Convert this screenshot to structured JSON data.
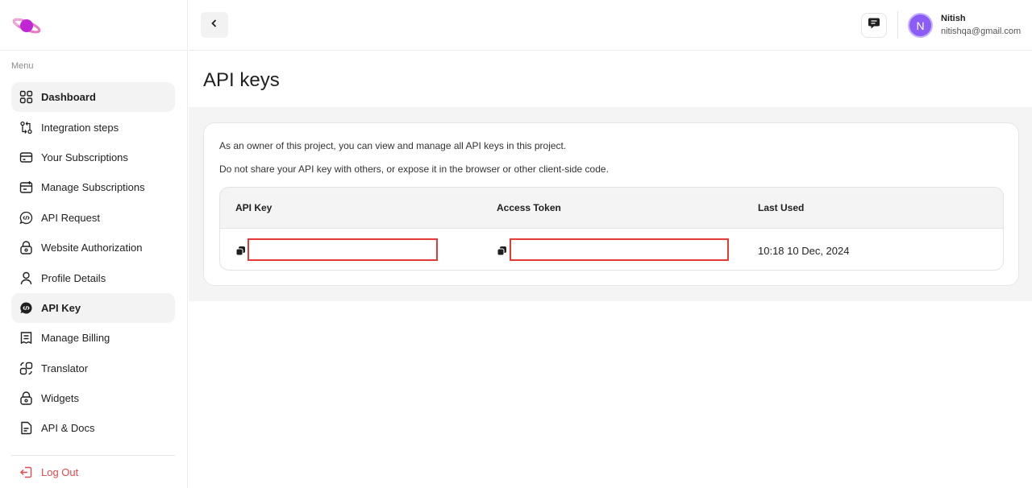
{
  "sidebar": {
    "menu_label": "Menu",
    "items": [
      {
        "label": "Dashboard",
        "icon": "grid-icon",
        "active": true
      },
      {
        "label": "Integration steps",
        "icon": "git-compare-icon"
      },
      {
        "label": "Your Subscriptions",
        "icon": "card-icon"
      },
      {
        "label": "Manage Subscriptions",
        "icon": "calendar-plus-icon"
      },
      {
        "label": "API Request",
        "icon": "code-chat-icon"
      },
      {
        "label": "Website Authorization",
        "icon": "lock-icon"
      },
      {
        "label": "Profile Details",
        "icon": "user-icon"
      },
      {
        "label": "API Key",
        "icon": "code-chat-filled-icon",
        "active": true
      },
      {
        "label": "Manage Billing",
        "icon": "receipt-icon"
      },
      {
        "label": "Translator",
        "icon": "translate-icon"
      },
      {
        "label": "Widgets",
        "icon": "lock-icon"
      },
      {
        "label": "API & Docs",
        "icon": "document-icon"
      }
    ],
    "logout_label": "Log Out"
  },
  "header": {
    "user_initial": "N",
    "user_name": "Nitish",
    "user_email": "nitishqa@gmail.com"
  },
  "main": {
    "title": "API keys",
    "description_1": "As an owner of this project, you can view and manage all API keys in this project.",
    "description_2": "Do not share your API key with others, or expose it in the browser or other client-side code.",
    "table": {
      "columns": [
        "API Key",
        "Access Token",
        "Last Used"
      ],
      "rows": [
        {
          "api_key": "",
          "access_token": "",
          "last_used": "10:18 10 Dec, 2024"
        }
      ]
    }
  },
  "colors": {
    "accent": "#8b5cf6",
    "logout": "#e5484d",
    "redaction": "#e53935",
    "logo": "#d946a8"
  }
}
